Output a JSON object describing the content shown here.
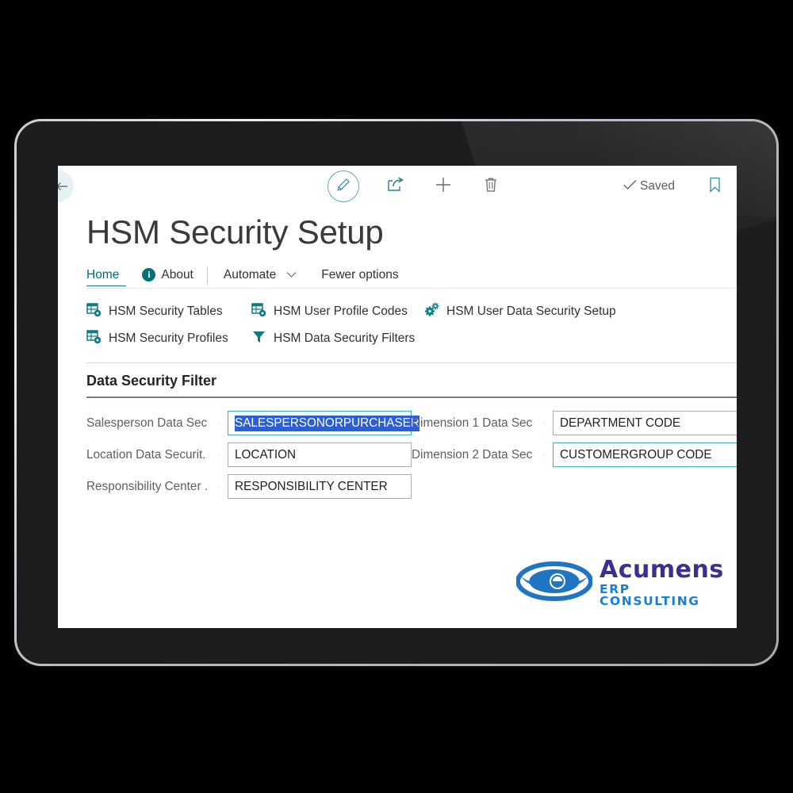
{
  "app": {
    "page_title": "HSM Security Setup",
    "save_status": "Saved"
  },
  "commandbar": {
    "back_icon": "back-arrow-icon",
    "edit_icon": "pencil-edit-icon",
    "share_icon": "share-icon",
    "new_icon": "plus-new-icon",
    "delete_icon": "trash-delete-icon",
    "check_icon": "check-icon",
    "bookmark_icon": "bookmark-icon"
  },
  "nav": {
    "items": [
      {
        "label": "Home",
        "active": true,
        "icon": null,
        "chevron": false
      },
      {
        "label": "About",
        "active": false,
        "icon": "info-icon",
        "chevron": false
      },
      {
        "label": "Automate",
        "active": false,
        "icon": null,
        "chevron": true
      },
      {
        "label": "Fewer options",
        "active": false,
        "icon": null,
        "chevron": false
      }
    ]
  },
  "ribbon": {
    "actions": [
      {
        "label": "HSM Security Tables",
        "icon": "table-settings-icon"
      },
      {
        "label": "HSM User Profile Codes",
        "icon": "table-settings-icon"
      },
      {
        "label": "HSM User Data Security Setup",
        "icon": "gears-icon"
      },
      {
        "label": "HSM Security Profiles",
        "icon": "table-settings-icon"
      },
      {
        "label": "HSM Data Security Filters",
        "icon": "funnel-filter-icon"
      }
    ]
  },
  "section": {
    "title": "Data Security Filter",
    "left_fields": [
      {
        "label": "Salesperson Data Sec...",
        "value": "SALESPERSONORPURCHASER",
        "focused": true,
        "selected": true
      },
      {
        "label": "Location Data Securit...",
        "value": "LOCATION",
        "focused": false,
        "selected": false
      },
      {
        "label": "Responsibility Center ...",
        "value": "RESPONSIBILITY CENTER",
        "focused": false,
        "selected": false
      }
    ],
    "right_fields": [
      {
        "label": "Dimension 1 Data Sec...",
        "value": "DEPARTMENT CODE",
        "focused": false,
        "selected": false
      },
      {
        "label": "Dimension 2 Data Sec...",
        "value": "CUSTOMERGROUP CODE",
        "focused": true,
        "selected": false
      }
    ],
    "dots": "· ·"
  },
  "logo": {
    "name": "Acumens",
    "tagline": "ERP CONSULTING",
    "eye_icon": "acumens-eye-logo-icon"
  },
  "colors": {
    "accent_teal": "#0f7b85",
    "focus_border": "#3fb2c0",
    "selection_blue": "#2c5fd4",
    "logo_purple": "#3b2f8f",
    "logo_blue": "#1a7fd4",
    "bezel_black": "#1d1d1f"
  }
}
